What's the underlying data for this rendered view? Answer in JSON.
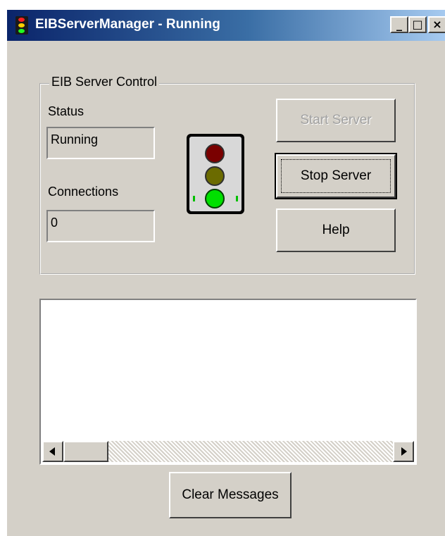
{
  "window": {
    "title": "EIBServerManager - Running",
    "minimize_glyph": "_",
    "maximize_glyph": "□",
    "close_glyph": "×",
    "title_gradient": [
      "#0a246a",
      "#a6caf0"
    ]
  },
  "server_control": {
    "group_label": "EIB Server Control",
    "status_label": "Status",
    "status_value": "Running",
    "connections_label": "Connections",
    "connections_value": "0",
    "traffic_light": {
      "active_light": "green",
      "colors": {
        "red": "#7a0000",
        "yellow": "#6b6b00",
        "green": "#00e000"
      }
    },
    "buttons": {
      "start": "Start Server",
      "stop": "Stop Server",
      "help": "Help"
    },
    "start_enabled": false
  },
  "messages": {
    "items": [],
    "clear_button": "Clear Messages"
  }
}
